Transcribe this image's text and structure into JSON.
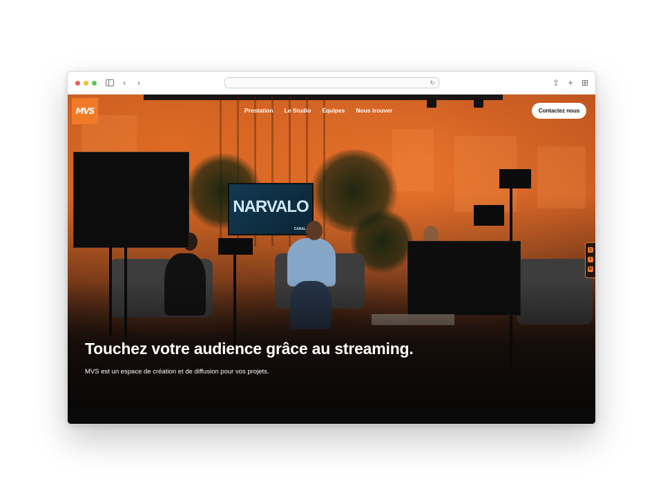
{
  "browser": {
    "url": "",
    "icons": {
      "sidebar": "sidebar-icon",
      "back": "chevron-left-icon",
      "forward": "chevron-right-icon",
      "reload": "reload-icon",
      "share": "share-icon",
      "new_tab": "plus-icon",
      "tabs": "tab-overview-icon"
    },
    "glyphs": {
      "back": "‹",
      "forward": "›",
      "reload": "↻",
      "share": "⇪",
      "new_tab": "+",
      "tabs": "⊞"
    }
  },
  "site": {
    "logo_text": "MVS",
    "nav": [
      "Prestation",
      "Le Studio",
      "Équipes",
      "Nous trouver"
    ],
    "cta": "Contactez nous",
    "hero": {
      "headline": "Touchez votre audience grâce au streaming.",
      "subline": "MVS est un espace de création et de diffusion pour vos projets."
    },
    "background_screen_text": "NARVALO",
    "background_screen_small": "CANAL+",
    "social": [
      "instagram-icon",
      "twitter-icon",
      "linkedin-icon"
    ],
    "social_glyphs": [
      "◎",
      "t",
      "in"
    ],
    "colors": {
      "accent": "#f07a26",
      "text": "#ffffff"
    }
  }
}
